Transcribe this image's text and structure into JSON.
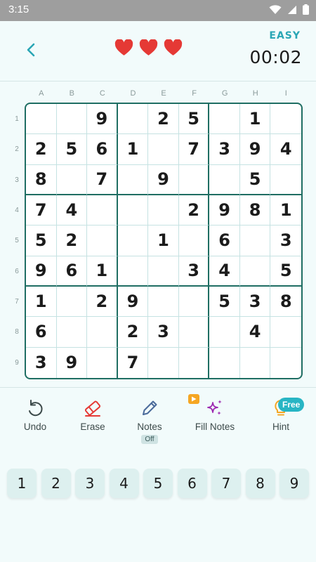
{
  "status_bar": {
    "time": "3:15"
  },
  "header": {
    "difficulty": "EASY",
    "timer": "00:02",
    "lives": 3
  },
  "board": {
    "col_labels": [
      "A",
      "B",
      "C",
      "D",
      "E",
      "F",
      "G",
      "H",
      "I"
    ],
    "row_labels": [
      "1",
      "2",
      "3",
      "4",
      "5",
      "6",
      "7",
      "8",
      "9"
    ],
    "cells": [
      [
        "",
        "",
        "9",
        "",
        "2",
        "5",
        "",
        "1",
        ""
      ],
      [
        "2",
        "5",
        "6",
        "1",
        "",
        "7",
        "3",
        "9",
        "4"
      ],
      [
        "8",
        "",
        "7",
        "",
        "9",
        "",
        "",
        "5",
        ""
      ],
      [
        "7",
        "4",
        "",
        "",
        "",
        "2",
        "9",
        "8",
        "1"
      ],
      [
        "5",
        "2",
        "",
        "",
        "1",
        "",
        "6",
        "",
        "3"
      ],
      [
        "9",
        "6",
        "1",
        "",
        "",
        "3",
        "4",
        "",
        "5"
      ],
      [
        "1",
        "",
        "2",
        "9",
        "",
        "",
        "5",
        "3",
        "8"
      ],
      [
        "6",
        "",
        "",
        "2",
        "3",
        "",
        "",
        "4",
        ""
      ],
      [
        "3",
        "9",
        "",
        "7",
        "",
        "",
        "",
        "",
        ""
      ]
    ]
  },
  "tools": {
    "undo": "Undo",
    "erase": "Erase",
    "notes": "Notes",
    "notes_state": "Off",
    "fill_notes": "Fill Notes",
    "hint": "Hint",
    "hint_badge": "Free"
  },
  "numpad": [
    "1",
    "2",
    "3",
    "4",
    "5",
    "6",
    "7",
    "8",
    "9"
  ],
  "colors": {
    "accent": "#2aa6b5",
    "board_border": "#1f6e63",
    "heart": "#e53935",
    "erase": "#e53935",
    "fill_notes": "#9c27b0",
    "hint": "#f5a623"
  }
}
